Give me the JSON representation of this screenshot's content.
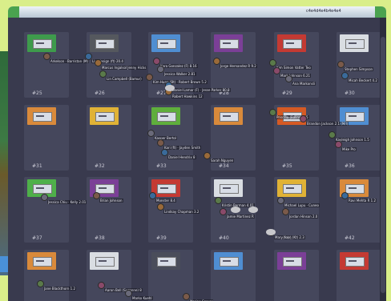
{
  "window": {
    "user_label": "c4e4d4e4b4e4e4"
  },
  "booths": [
    {
      "number": "#25",
      "color": "#3e9b4c"
    },
    {
      "number": "#26",
      "color": "#55585e"
    },
    {
      "number": "#27",
      "color": "#4f8ed2"
    },
    {
      "number": "#28",
      "color": "#7b3f97"
    },
    {
      "number": "#29",
      "color": "#c43a33"
    },
    {
      "number": "#30",
      "color": "#d9dde2"
    },
    {
      "number": "#31",
      "color": "#d98a3b"
    },
    {
      "number": "#32",
      "color": "#e0b236"
    },
    {
      "number": "#33",
      "color": "#5fae3c"
    },
    {
      "number": "#34",
      "color": "#d98a3b"
    },
    {
      "number": "#35",
      "color": "#d55a24"
    },
    {
      "number": "#36",
      "color": "#4f8ed2"
    },
    {
      "number": "#37",
      "color": "#4fb04a"
    },
    {
      "number": "#38",
      "color": "#7b3f97"
    },
    {
      "number": "#39",
      "color": "#c43a33"
    },
    {
      "number": "#40",
      "color": "#d9dde2"
    },
    {
      "number": "#41",
      "color": "#e0b236"
    },
    {
      "number": "#42",
      "color": "#d98a3b"
    },
    {
      "number": "#43",
      "color": "#d98a3b"
    },
    {
      "number": "#44",
      "color": "#d9dde2"
    },
    {
      "number": "#45",
      "color": "#4a4d5a"
    },
    {
      "number": "#46",
      "color": "#4f8ed2"
    },
    {
      "number": "#47",
      "color": "#7b3f97"
    },
    {
      "number": "#48",
      "color": "#c43a33"
    }
  ],
  "avatar_labels": [
    "Arkelson · Barristan (M)",
    "Livedesign (ft) 20.4",
    "Marcus Ingalsol Jenny Hicks",
    "Lin Campbell (Bamur)",
    "Kara Gonzalez (F) 8.16",
    "Jessica Walker 2.81",
    "Kim Hung (Bt) · Robert Brown 5.2",
    "Daniel Lamar (F) · Jesse Parker 80.8",
    "Jorge Hernandez R 9.2",
    "Kim Simon Vatter Teo",
    "Mark Johnson 6.21",
    "Ana Markonsli",
    "Stephen Simpson",
    "Micah Beckert 4.2",
    "Robert Hawkins 12",
    "Priscilla (Baline) 2.5",
    "Brandon Jackson 2.1 (M/l)",
    "Kasper Bertol",
    "Kari (ft) · Jayden Smith",
    "Daniel Hendrix 8",
    "Sarah Nguyen",
    "Kayleigh Johnson 1.5",
    "Mike Pro",
    "Jessica Chiu · Kelly 2.01",
    "Brian Johnson",
    "Monster 8.4",
    "Lindsay Chapman 3.2",
    "Kristin Berman 4.01",
    "Jamie Martinez R",
    "Michael Lupu · Cuneo",
    "Jordan Hinson 2.0",
    "Ravi Mehta R 1.2",
    "Mary Yoon (Kt) 2.3",
    "Jane Blackthorn 1.2",
    "Aaron Bell (Suzanne) 8",
    "Marko Kuehl",
    "Marine Carver"
  ]
}
